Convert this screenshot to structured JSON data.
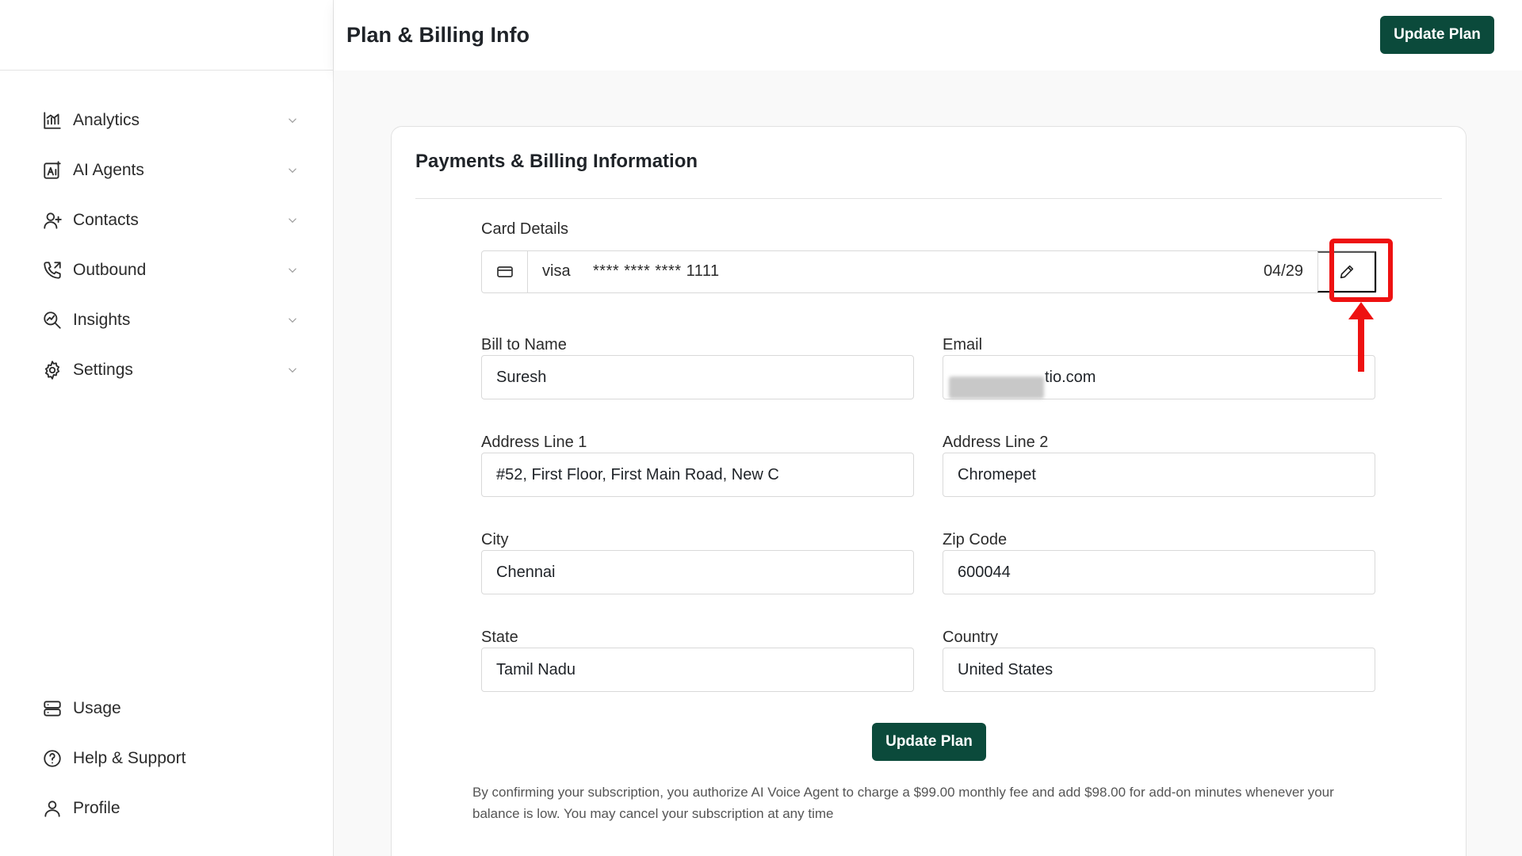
{
  "header": {
    "title": "Plan & Billing Info",
    "update_button": "Update Plan"
  },
  "sidebar": {
    "items": [
      {
        "label": "Analytics",
        "icon": "chart-icon"
      },
      {
        "label": "AI Agents",
        "icon": "ai-icon"
      },
      {
        "label": "Contacts",
        "icon": "user-plus-icon"
      },
      {
        "label": "Outbound",
        "icon": "phone-outgoing-icon"
      },
      {
        "label": "Insights",
        "icon": "insights-icon"
      },
      {
        "label": "Settings",
        "icon": "gear-icon"
      }
    ],
    "bottom_items": [
      {
        "label": "Usage",
        "icon": "database-icon"
      },
      {
        "label": "Help & Support",
        "icon": "help-icon"
      },
      {
        "label": "Profile",
        "icon": "user-icon"
      }
    ]
  },
  "billing": {
    "section_title": "Payments & Billing Information",
    "card_details_label": "Card Details",
    "card": {
      "brand": "visa",
      "number": "**** **** **** 1111",
      "expiry": "04/29"
    },
    "fields": {
      "bill_to_name": {
        "label": "Bill to Name",
        "value": "Suresh"
      },
      "email": {
        "label": "Email",
        "value": "tio.com"
      },
      "address_line_1": {
        "label": "Address Line 1",
        "value": "#52, First Floor, First Main Road, New C"
      },
      "address_line_2": {
        "label": "Address Line 2",
        "value": "Chromepet"
      },
      "city": {
        "label": "City",
        "value": "Chennai"
      },
      "zip_code": {
        "label": "Zip Code",
        "value": "600044"
      },
      "state": {
        "label": "State",
        "value": "Tamil Nadu"
      },
      "country": {
        "label": "Country",
        "value": "United States"
      }
    },
    "update_button": "Update Plan",
    "disclaimer": "By confirming your subscription, you authorize AI Voice Agent to charge a $99.00 monthly fee and add $98.00 for add-on minutes whenever your balance is low. You may cancel your subscription at any time"
  },
  "colors": {
    "primary": "#0b4a3b",
    "highlight": "#ee1111"
  }
}
